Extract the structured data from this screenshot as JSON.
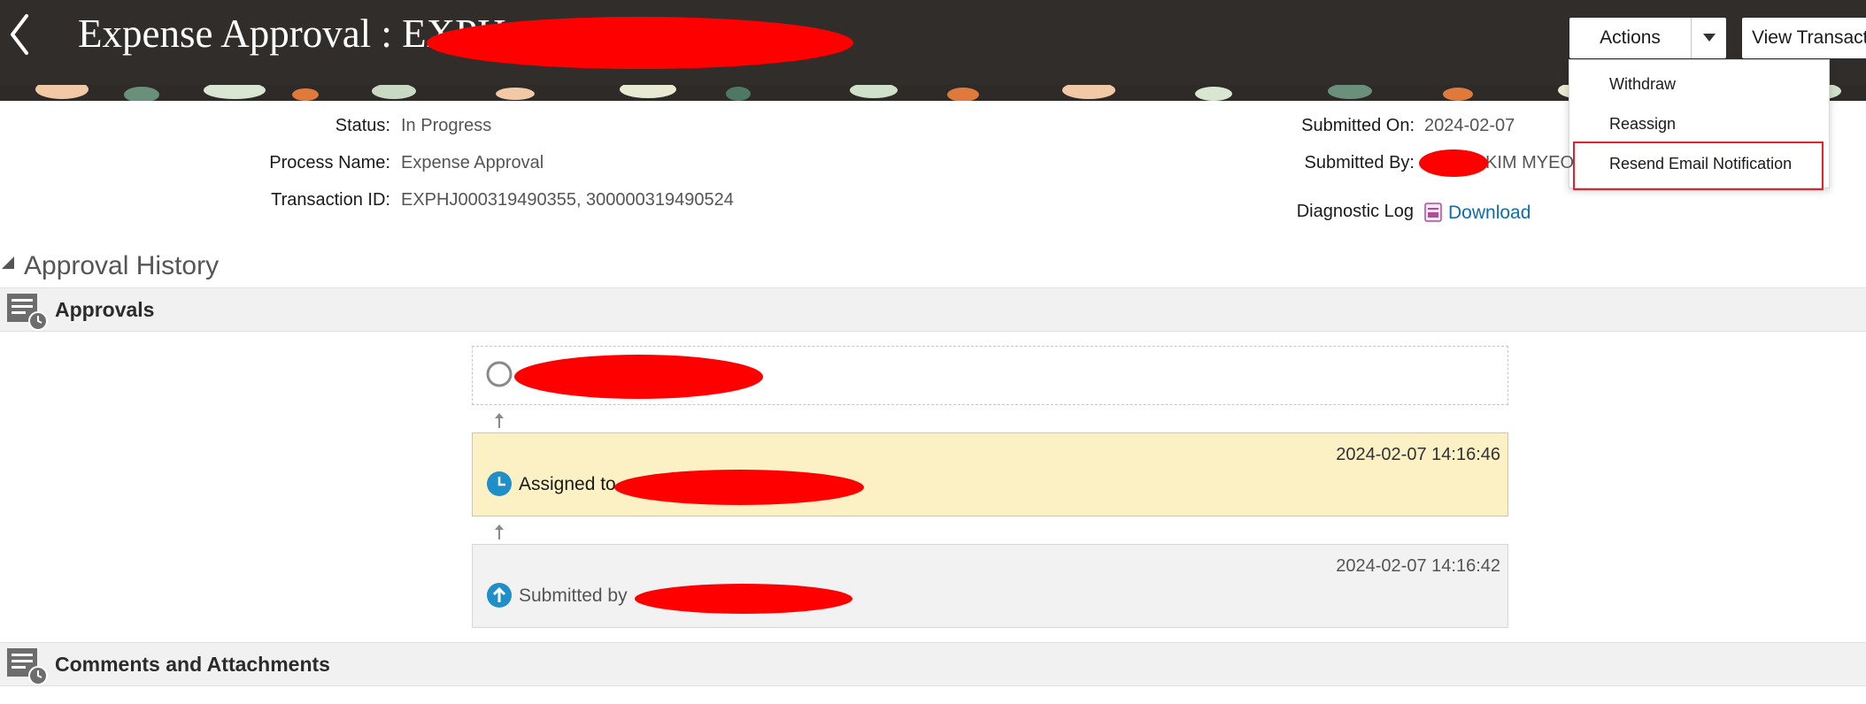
{
  "header": {
    "title": "Expense Approval : EXPH",
    "actions_label": "Actions",
    "view_label": "View Transaction"
  },
  "actions_menu": {
    "items": [
      "Withdraw",
      "Reassign",
      "Resend Email Notification"
    ]
  },
  "info": {
    "status_label": "Status:",
    "status_value": "In Progress",
    "process_label": "Process Name:",
    "process_value": "Expense Approval",
    "transaction_label": "Transaction ID:",
    "transaction_value": "EXPHJ000319490355, 300000319490524",
    "submitted_on_label": "Submitted On:",
    "submitted_on_value": "2024-02-07",
    "submitted_by_label": "Submitted By:",
    "submitted_by_value": "KIM MYEO",
    "diagnostic_label": "Diagnostic Log",
    "download_label": "Download"
  },
  "approval_history": {
    "section_title": "Approval History",
    "approvals_title": "Approvals",
    "steps": [
      {
        "status": "pending",
        "timestamp": "",
        "text": ""
      },
      {
        "status": "assigned",
        "timestamp": "2024-02-07 14:16:46",
        "text": "Assigned to"
      },
      {
        "status": "submitted",
        "timestamp": "2024-02-07 14:16:42",
        "text": "Submitted by"
      }
    ]
  },
  "comments": {
    "title": "Comments and Attachments"
  },
  "colors": {
    "header_bg": "#312d2a",
    "link": "#0e6fa6",
    "assigned_bg": "#fbf1c4",
    "highlight_border": "#e8202a",
    "redaction": "#ff0000"
  },
  "icons": [
    "back-chevron-icon",
    "caret-down-icon",
    "diagnostic-log-icon",
    "collapse-triangle-icon",
    "approvals-list-clock-icon",
    "pending-circle-icon",
    "clock-icon",
    "up-arrow-icon"
  ]
}
